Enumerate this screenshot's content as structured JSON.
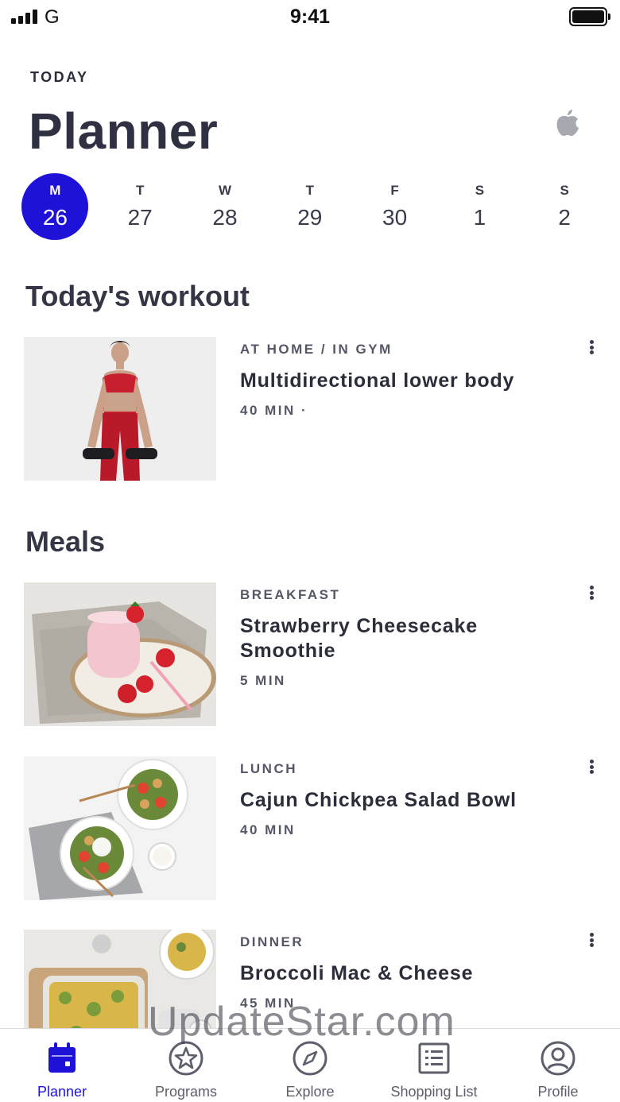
{
  "status_bar": {
    "carrier": "G",
    "time": "9:41"
  },
  "header": {
    "eyebrow": "TODAY",
    "title": "Planner"
  },
  "week": [
    {
      "dow": "M",
      "date": "26",
      "selected": true
    },
    {
      "dow": "T",
      "date": "27"
    },
    {
      "dow": "W",
      "date": "28"
    },
    {
      "dow": "T",
      "date": "29"
    },
    {
      "dow": "F",
      "date": "30"
    },
    {
      "dow": "S",
      "date": "1"
    },
    {
      "dow": "S",
      "date": "2"
    }
  ],
  "workout_section": {
    "title": "Today's workout",
    "item": {
      "tag": "AT HOME / IN GYM",
      "name": "Multidirectional lower body",
      "duration": "40 MIN ·"
    }
  },
  "meals_section": {
    "title": "Meals",
    "items": [
      {
        "tag": "BREAKFAST",
        "name": "Strawberry Cheesecake Smoothie",
        "duration": "5 MIN"
      },
      {
        "tag": "LUNCH",
        "name": "Cajun Chickpea Salad Bowl",
        "duration": "40 MIN"
      },
      {
        "tag": "DINNER",
        "name": "Broccoli Mac & Cheese",
        "duration": "45 MIN"
      }
    ]
  },
  "watermark": "UpdateStar.com",
  "tabbar": {
    "tabs": [
      {
        "label": "Planner",
        "icon": "calendar-icon",
        "active": true
      },
      {
        "label": "Programs",
        "icon": "star-icon"
      },
      {
        "label": "Explore",
        "icon": "compass-icon"
      },
      {
        "label": "Shopping List",
        "icon": "list-icon"
      },
      {
        "label": "Profile",
        "icon": "user-icon"
      }
    ]
  },
  "colors": {
    "accent": "#1e12d8",
    "text": "#2b2d3a",
    "muted": "#5d5f6d"
  }
}
